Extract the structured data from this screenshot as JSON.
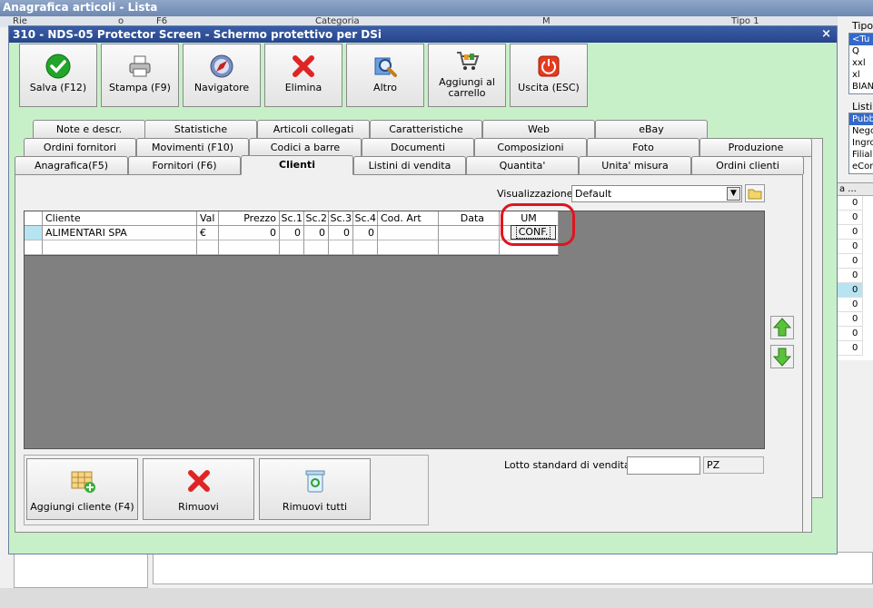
{
  "background": {
    "title": "Anagrafica articoli  - Lista",
    "column_hints": [
      "Rie",
      "o",
      "F6",
      "Categoria",
      "M",
      "Tipo 1"
    ],
    "tipo_label": "Tipo",
    "tipo_items": [
      "<Tu",
      "Q",
      "xxl",
      "xl",
      "BIAN"
    ],
    "listini_label": "Listin",
    "listini_items": [
      "Pubb",
      "Nego",
      "Ingro",
      "Filial",
      "eCon"
    ],
    "grid_header": "a ...",
    "grid_values": [
      "0",
      "0",
      "0",
      "0",
      "0",
      "0",
      "0",
      "0",
      "0",
      "0",
      "0"
    ]
  },
  "dialog": {
    "title": "310 - NDS-05 Protector Screen - Schermo protettivo per DSi",
    "close_label": "×",
    "toolbar": [
      {
        "label": "Salva (F12)",
        "icon": "check-icon"
      },
      {
        "label": "Stampa (F9)",
        "icon": "printer-icon"
      },
      {
        "label": "Navigatore",
        "icon": "compass-icon"
      },
      {
        "label": "Elimina",
        "icon": "delete-x-icon"
      },
      {
        "label": "Altro",
        "icon": "magnifier-icon"
      },
      {
        "label": "Aggiungi al carrello",
        "icon": "cart-icon"
      },
      {
        "label": "Uscita (ESC)",
        "icon": "power-icon"
      }
    ],
    "tabs_row1": [
      "Note e descr.",
      "Statistiche",
      "Articoli collegati",
      "Caratteristiche",
      "Web",
      "eBay"
    ],
    "tabs_row2": [
      "Ordini fornitori",
      "Movimenti (F10)",
      "Codici a barre",
      "Documenti",
      "Composizioni",
      "Foto",
      "Produzione"
    ],
    "tabs_row3": [
      "Anagrafica(F5)",
      "Fornitori (F6)",
      "Clienti",
      "Listini di vendita",
      "Quantita'",
      "Unita' misura",
      "Ordini clienti"
    ],
    "visualizzazione_label": "Visualizzazione :",
    "visualizzazione_value": "Default",
    "grid": {
      "columns": [
        "",
        "Cliente",
        "Val",
        "Prezzo",
        "Sc.1",
        "Sc.2",
        "Sc.3",
        "Sc.4",
        "Cod. Art",
        "Data",
        "UM"
      ],
      "rows": [
        {
          "cliente": "ALIMENTARI SPA",
          "val": "€",
          "prezzo": "0",
          "sc1": "0",
          "sc2": "0",
          "sc3": "0",
          "sc4": "0",
          "cod_art": "",
          "data": "",
          "um": "CONF."
        }
      ]
    },
    "buttons": [
      {
        "label": "Aggiungi cliente (F4)",
        "icon": "add-grid-icon"
      },
      {
        "label": "Rimuovi",
        "icon": "remove-x-icon"
      },
      {
        "label": "Rimuovi tutti",
        "icon": "recycle-bin-icon"
      }
    ],
    "lotto_label": "Lotto standard di vendita :",
    "lotto_value": "",
    "lotto_um": "PZ"
  }
}
